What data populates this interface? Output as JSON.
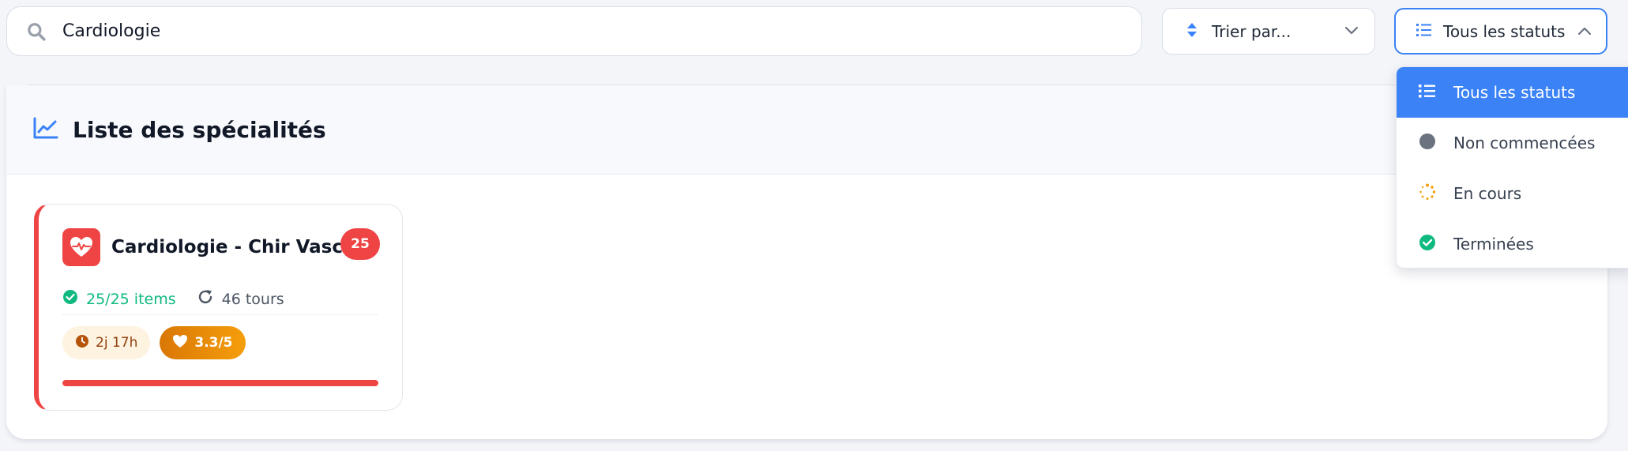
{
  "search": {
    "value": "Cardiologie",
    "icon": "search-icon"
  },
  "sort": {
    "label": "Trier par...",
    "icon": "sort-arrows-icon"
  },
  "status_filter": {
    "label": "Tous les statuts",
    "icon": "list-icon",
    "expanded": true,
    "accent": "#3b82f6"
  },
  "dropdown": {
    "items": [
      {
        "label": "Tous les statuts",
        "icon": "list-icon",
        "selected": true
      },
      {
        "label": "Non commencées",
        "icon": "gray-dot-icon",
        "selected": false
      },
      {
        "label": "En cours",
        "icon": "spinner-icon",
        "selected": false
      },
      {
        "label": "Terminées",
        "icon": "check-circle-icon",
        "selected": false
      }
    ]
  },
  "panel": {
    "title": "Liste des spécialités",
    "icon": "chart-line-icon"
  },
  "card": {
    "name": "Cardiologie - Chir Vasc.",
    "icon": "heart-pulse-icon",
    "count": "25",
    "items_text": "25/25 items",
    "tours_text": "46 tours",
    "time_text": "2j 17h",
    "rating_text": "3.3/5",
    "progress": 1.0,
    "accent": "#ef4444"
  },
  "colors": {
    "success": "#10b981",
    "warning": "#f59e0b",
    "danger": "#ef4444",
    "primary": "#3b82f6",
    "neutral_dot": "#6b7280"
  }
}
